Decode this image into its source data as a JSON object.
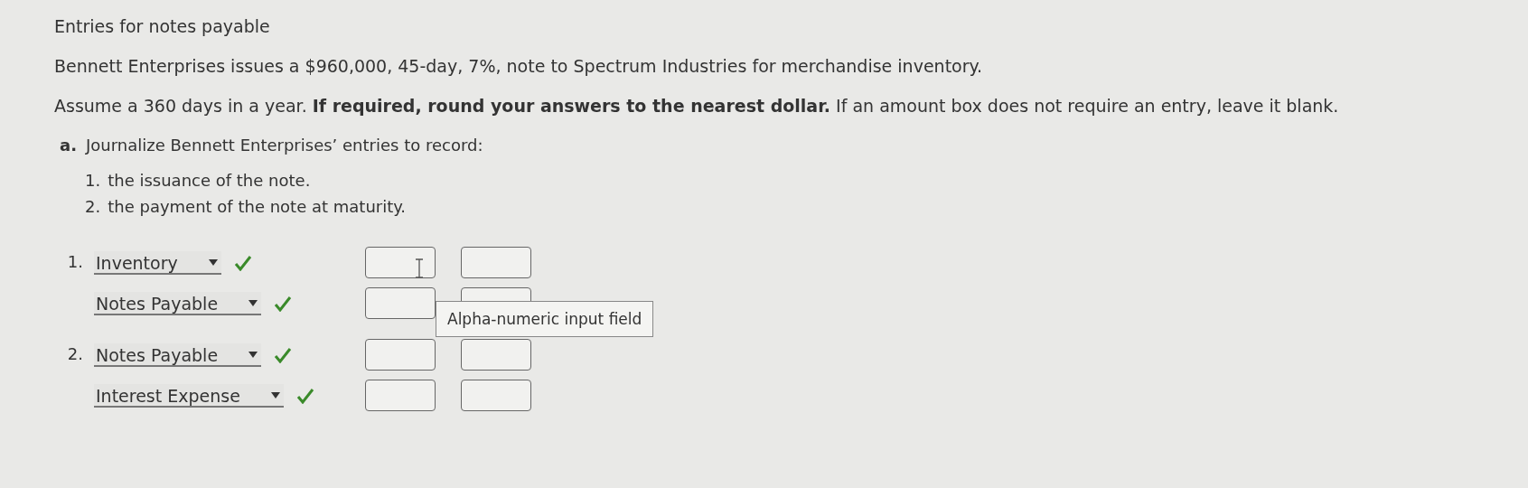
{
  "title": "Entries for notes payable",
  "problem": "Bennett Enterprises issues a $960,000, 45-day, 7%, note to Spectrum Industries for merchandise inventory.",
  "instructions": "Assume a 360 days in a year. **If required, round your answers to the nearest dollar.** If an amount box does not require an entry, leave it blank.",
  "part": {
    "label": "a.",
    "text": "Journalize Bennett Enterprises’ entries to record:",
    "steps": [
      {
        "number": "1.",
        "text": "the issuance of the note."
      },
      {
        "number": "2.",
        "text": "the payment of the note at maturity."
      }
    ]
  },
  "entries": [
    {
      "number": "1.",
      "lines": [
        {
          "account": "Inventory",
          "correct": true
        },
        {
          "account": "Notes Payable",
          "correct": true
        }
      ]
    },
    {
      "number": "2.",
      "lines": [
        {
          "account": "Notes Payable",
          "correct": true
        },
        {
          "account": "Interest Expense",
          "correct": true
        }
      ]
    }
  ],
  "tooltip": "Alpha-numeric input field"
}
